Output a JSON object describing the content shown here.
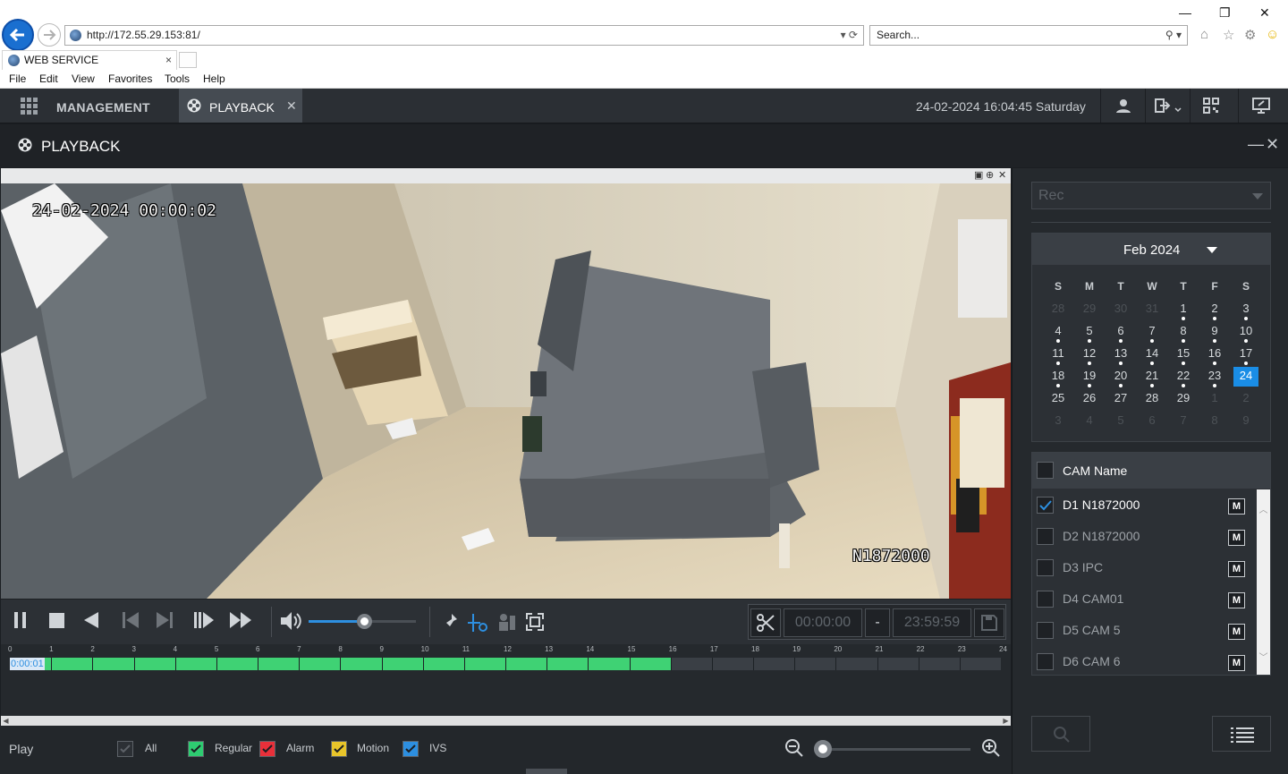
{
  "browser": {
    "address": "http://172.55.29.153:81/",
    "search_placeholder": "Search...",
    "tab_title": "WEB SERVICE",
    "menu": [
      "File",
      "Edit",
      "View",
      "Favorites",
      "Tools",
      "Help"
    ]
  },
  "app": {
    "nav": {
      "management": "MANAGEMENT",
      "playback_tab": "PLAYBACK"
    },
    "datetime": "24-02-2024 16:04:45 Saturday",
    "panel_title": "PLAYBACK"
  },
  "video": {
    "osd_time": "24-02-2024 00:00:02",
    "osd_name": "N1872000"
  },
  "controls": {
    "volume_percent": 52,
    "clip_start": "00:00:00",
    "clip_sep": "-",
    "clip_end": "23:59:59"
  },
  "timeline": {
    "hours": [
      "0",
      "1",
      "2",
      "3",
      "4",
      "5",
      "6",
      "7",
      "8",
      "9",
      "10",
      "11",
      "12",
      "13",
      "14",
      "15",
      "16",
      "17",
      "18",
      "19",
      "20",
      "21",
      "22",
      "23",
      "24"
    ],
    "recorded_until_hour": 16,
    "current_time": "0:00:01"
  },
  "filters": {
    "play_label": "Play",
    "items": [
      {
        "label": "All",
        "color": "#2c3035",
        "checked": true
      },
      {
        "label": "Regular",
        "color": "#2ecc71",
        "checked": true
      },
      {
        "label": "Alarm",
        "color": "#e8303a",
        "checked": true
      },
      {
        "label": "Motion",
        "color": "#e8c52a",
        "checked": true
      },
      {
        "label": "IVS",
        "color": "#2d8fe0",
        "checked": true
      }
    ]
  },
  "sidebar": {
    "rec_type": "Rec",
    "calendar": {
      "month": "Feb 2024",
      "dow": [
        "S",
        "M",
        "T",
        "W",
        "T",
        "F",
        "S"
      ],
      "weeks": [
        [
          {
            "d": "28",
            "o": true
          },
          {
            "d": "29",
            "o": true
          },
          {
            "d": "30",
            "o": true
          },
          {
            "d": "31",
            "o": true
          },
          {
            "d": "1",
            "r": true
          },
          {
            "d": "2",
            "r": true
          },
          {
            "d": "3",
            "r": true
          }
        ],
        [
          {
            "d": "4",
            "r": true
          },
          {
            "d": "5",
            "r": true
          },
          {
            "d": "6",
            "r": true
          },
          {
            "d": "7",
            "r": true
          },
          {
            "d": "8",
            "r": true
          },
          {
            "d": "9",
            "r": true
          },
          {
            "d": "10",
            "r": true
          }
        ],
        [
          {
            "d": "11",
            "r": true
          },
          {
            "d": "12",
            "r": true
          },
          {
            "d": "13",
            "r": true
          },
          {
            "d": "14",
            "r": true
          },
          {
            "d": "15",
            "r": true
          },
          {
            "d": "16",
            "r": true
          },
          {
            "d": "17",
            "r": true
          }
        ],
        [
          {
            "d": "18",
            "r": true
          },
          {
            "d": "19",
            "r": true
          },
          {
            "d": "20",
            "r": true
          },
          {
            "d": "21",
            "r": true
          },
          {
            "d": "22",
            "r": true
          },
          {
            "d": "23",
            "r": true
          },
          {
            "d": "24",
            "sel": true
          }
        ],
        [
          {
            "d": "25"
          },
          {
            "d": "26"
          },
          {
            "d": "27"
          },
          {
            "d": "28"
          },
          {
            "d": "29"
          },
          {
            "d": "1",
            "o": true
          },
          {
            "d": "2",
            "o": true
          }
        ],
        [
          {
            "d": "3",
            "o": true
          },
          {
            "d": "4",
            "o": true
          },
          {
            "d": "5",
            "o": true
          },
          {
            "d": "6",
            "o": true
          },
          {
            "d": "7",
            "o": true
          },
          {
            "d": "8",
            "o": true
          },
          {
            "d": "9",
            "o": true
          }
        ]
      ]
    },
    "cam_header": "CAM Name",
    "cameras": [
      {
        "name": "D1 N1872000",
        "checked": true,
        "m": "M"
      },
      {
        "name": "D2 N1872000",
        "checked": false,
        "m": "M"
      },
      {
        "name": "D3 IPC",
        "checked": false,
        "m": "M"
      },
      {
        "name": "D4 CAM01",
        "checked": false,
        "m": "M"
      },
      {
        "name": "D5 CAM 5",
        "checked": false,
        "m": "M"
      },
      {
        "name": "D6 CAM 6",
        "checked": false,
        "m": "M"
      }
    ]
  }
}
